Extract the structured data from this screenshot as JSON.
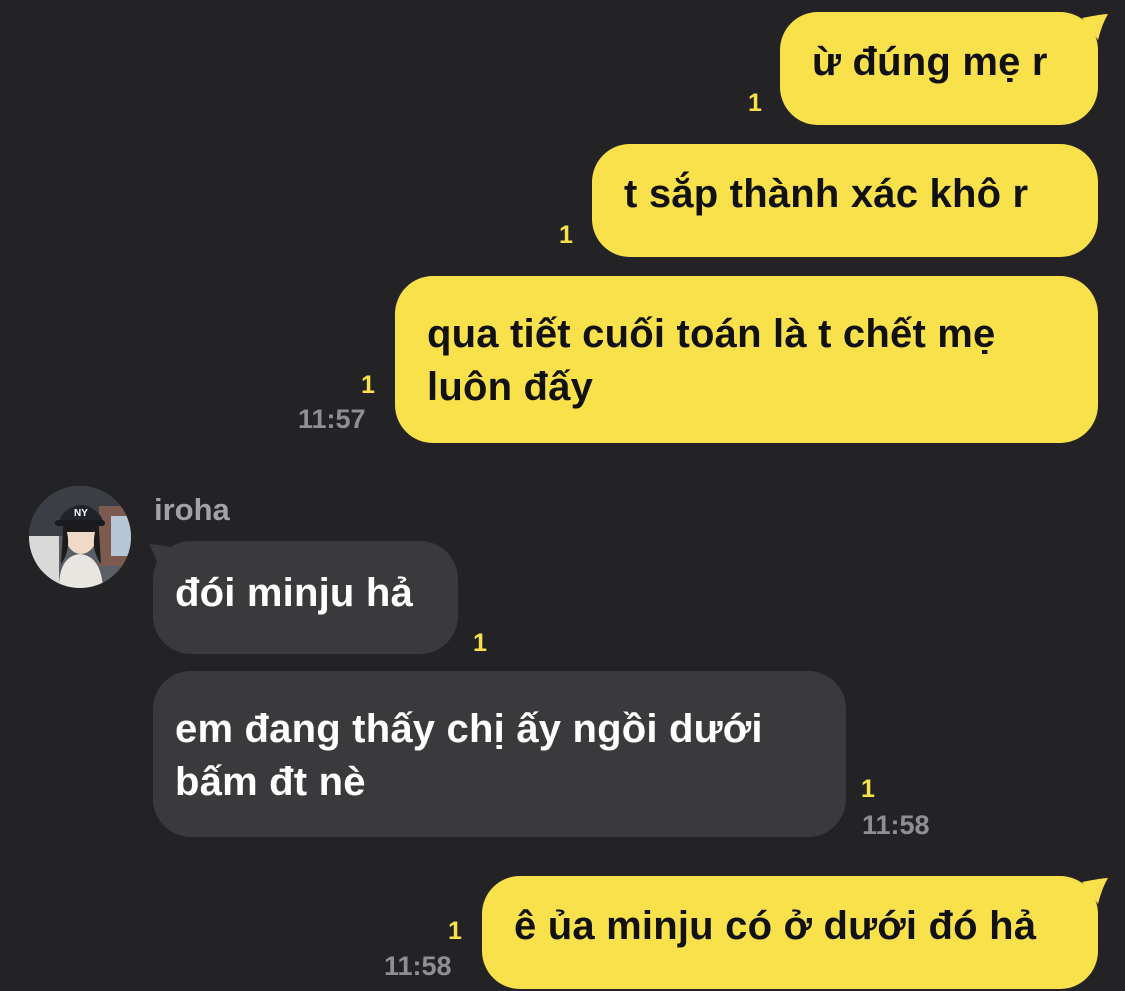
{
  "colors": {
    "background": "#232325",
    "outgoing_bubble": "#F9E14B",
    "incoming_bubble": "#3A3A3D",
    "unread_count": "#F9E14B",
    "timestamp": "#8E8E93"
  },
  "contact": {
    "name": "iroha",
    "avatar_icon": "profile-photo"
  },
  "messages": [
    {
      "direction": "outgoing",
      "text": "ừ đúng mẹ r",
      "unread": "1",
      "time": ""
    },
    {
      "direction": "outgoing",
      "text": "t sắp thành xác khô r",
      "unread": "1",
      "time": ""
    },
    {
      "direction": "outgoing",
      "text": "qua tiết cuối toán là t chết mẹ\nluôn đấy",
      "unread": "1",
      "time": "11:57"
    },
    {
      "direction": "incoming",
      "text": "đói minju hả",
      "unread": "1",
      "time": ""
    },
    {
      "direction": "incoming",
      "text": "em đang thấy chị ấy ngồi dưới\nbấm đt nè",
      "unread": "1",
      "time": "11:58"
    },
    {
      "direction": "outgoing",
      "text": "ê ủa minju có ở dưới đó hả",
      "unread": "1",
      "time": "11:58"
    }
  ]
}
